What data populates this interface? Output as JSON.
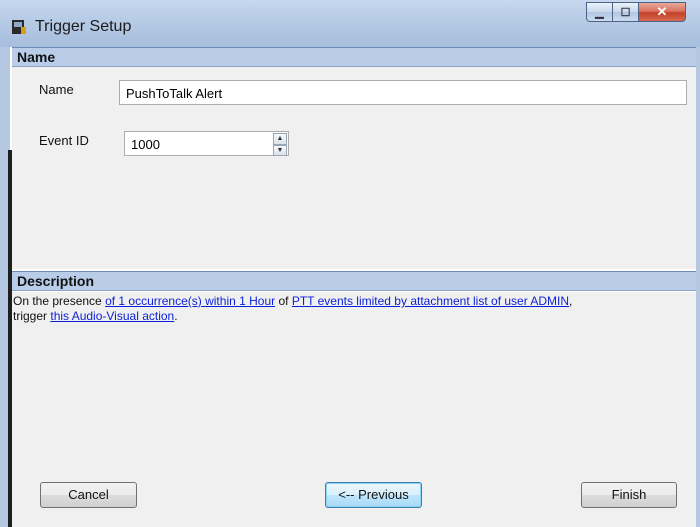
{
  "window": {
    "title": "Trigger Setup"
  },
  "name_section": {
    "header": "Name",
    "name_label": "Name",
    "name_value": "PushToTalk Alert",
    "event_label": "Event ID",
    "event_value": "1000"
  },
  "description_section": {
    "header": "Description",
    "text_1": "On the presence ",
    "link_1": "of 1 occurrence(s) within 1 Hour",
    "text_2": " of ",
    "link_2": "PTT events limited by attachment list of user ADMIN",
    "text_3": ",",
    "text_4": "trigger ",
    "link_3": "this Audio-Visual action",
    "text_5": "."
  },
  "buttons": {
    "cancel": "Cancel",
    "previous": "<-- Previous",
    "finish": "Finish"
  },
  "colors": {
    "section_header_bg": "#b9cde9",
    "link": "#0b1fd6",
    "panel_bg": "#f0f0f0"
  },
  "icons": [
    "app-icon",
    "minimize-icon",
    "maximize-icon",
    "close-icon",
    "spin-up-icon",
    "spin-down-icon"
  ]
}
